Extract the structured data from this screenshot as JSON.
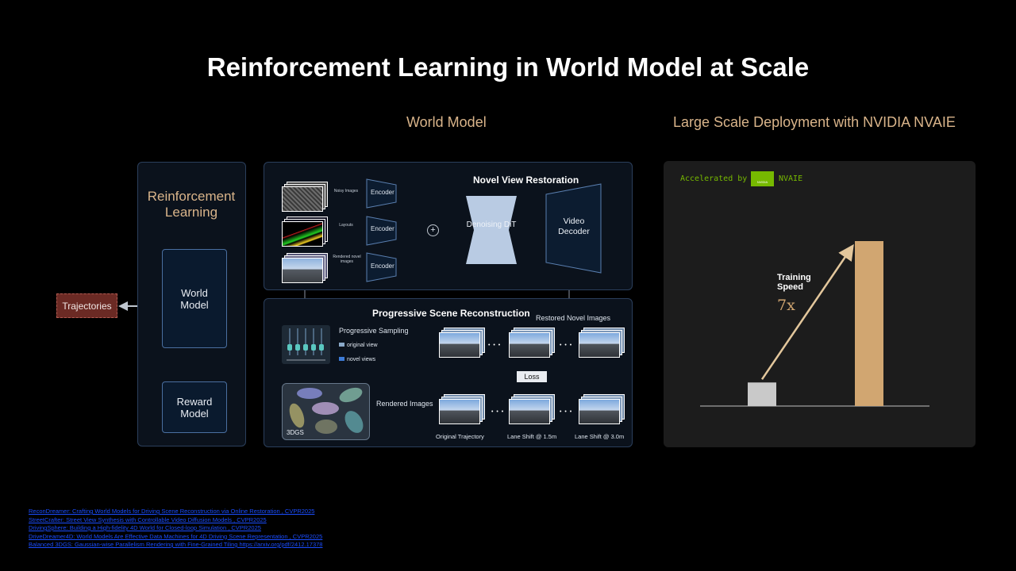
{
  "title": "Reinforcement Learning in World Model at Scale",
  "sections": {
    "world_model": "World Model",
    "deployment": "Large Scale Deployment with NVIDIA NVAIE"
  },
  "rl": {
    "label": "Reinforcement Learning",
    "world_model": "World Model",
    "reward_model": "Reward Model",
    "trajectories": "Trajectories"
  },
  "nvr": {
    "title": "Novel View Restoration",
    "inputs": [
      {
        "label": "Noisy Images",
        "encoder": "Encoder"
      },
      {
        "label": "Layouts",
        "encoder": "Encoder"
      },
      {
        "label": "Rendered novel images",
        "encoder": "Encoder"
      }
    ],
    "plus": "+",
    "dit": "Denoising DiT",
    "decoder": "Video Decoder"
  },
  "psr": {
    "title": "Progressive Scene Reconstruction",
    "progressive_sampling": "Progressive Sampling",
    "legend_original": "original view",
    "legend_novel": "novel views",
    "restored": "Restored Novel Images",
    "loss": "Loss",
    "rendered": "Rendered Images",
    "gs": "3DGS",
    "ellipsis": "• • •",
    "captions": [
      "Original Trajectory",
      "Lane Shift @ 1.5m",
      "Lane Shift @ 3.0m"
    ]
  },
  "deploy": {
    "accelerated": "Accelerated by",
    "nvidia_logo": "NVIDIA",
    "nvaie": "NVAIE",
    "training_speed": "Training Speed",
    "speedup": "7x"
  },
  "chart_data": {
    "type": "bar",
    "categories": [
      "",
      ""
    ],
    "values": [
      1,
      7
    ],
    "ylim": [
      0,
      7
    ],
    "annotations": [
      "Training Speed",
      "7x"
    ],
    "colors": [
      "#c9c9c9",
      "#d1a671"
    ]
  },
  "references": [
    "ReconDreamer: Crafting World Models for Driving Scene Reconstruction via Online Restoration , CVPR2025",
    "StreetCrafter: Street View Synthesis with Controllable Video Diffusion Models , CVPR2025",
    "DrivingSphere: Building a High-fidelity 4D World for Closed-loop Simulation , CVPR2025",
    "DriveDreamer4D: World Models Are Effective Data Machines for 4D Driving Scene Representation , CVPR2025",
    "Balanced 3DGS: Gaussian-wise Parallelism Rendering with Fine-Grained Tiling https://arxiv.org/pdf/2412.17378"
  ],
  "colors": {
    "accent": "#d9b48a",
    "panel_border": "#2b3f5c",
    "bar_small": "#c9c9c9",
    "bar_large": "#d1a671",
    "nvidia_green": "#76b900",
    "trajectories_bg": "#6b2a24"
  }
}
